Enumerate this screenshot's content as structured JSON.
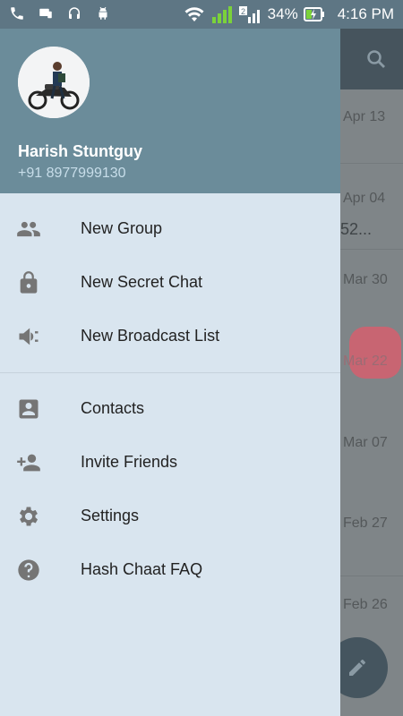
{
  "status_bar": {
    "battery": "34%",
    "time": "4:16 PM"
  },
  "drawer": {
    "user_name": "Harish Stuntguy",
    "user_phone": "+91 8977999130",
    "menu": [
      {
        "label": "New Group",
        "icon": "group-icon"
      },
      {
        "label": "New Secret Chat",
        "icon": "lock-icon"
      },
      {
        "label": "New Broadcast List",
        "icon": "megaphone-icon"
      },
      {
        "label": "Contacts",
        "icon": "contact-card-icon"
      },
      {
        "label": "Invite Friends",
        "icon": "add-person-icon"
      },
      {
        "label": "Settings",
        "icon": "gear-icon"
      },
      {
        "label": "Hash Chaat FAQ",
        "icon": "help-icon"
      }
    ]
  },
  "background_list": {
    "dates": [
      "Apr 13",
      "Apr 04",
      "Mar 30",
      "Mar 22",
      "Mar 07",
      "Feb 27",
      "Feb 26"
    ],
    "snippet": "52..."
  },
  "colors": {
    "header": "#6b8c9a",
    "drawer": "#d9e5ef",
    "icon": "#757575",
    "text": "#222222"
  }
}
